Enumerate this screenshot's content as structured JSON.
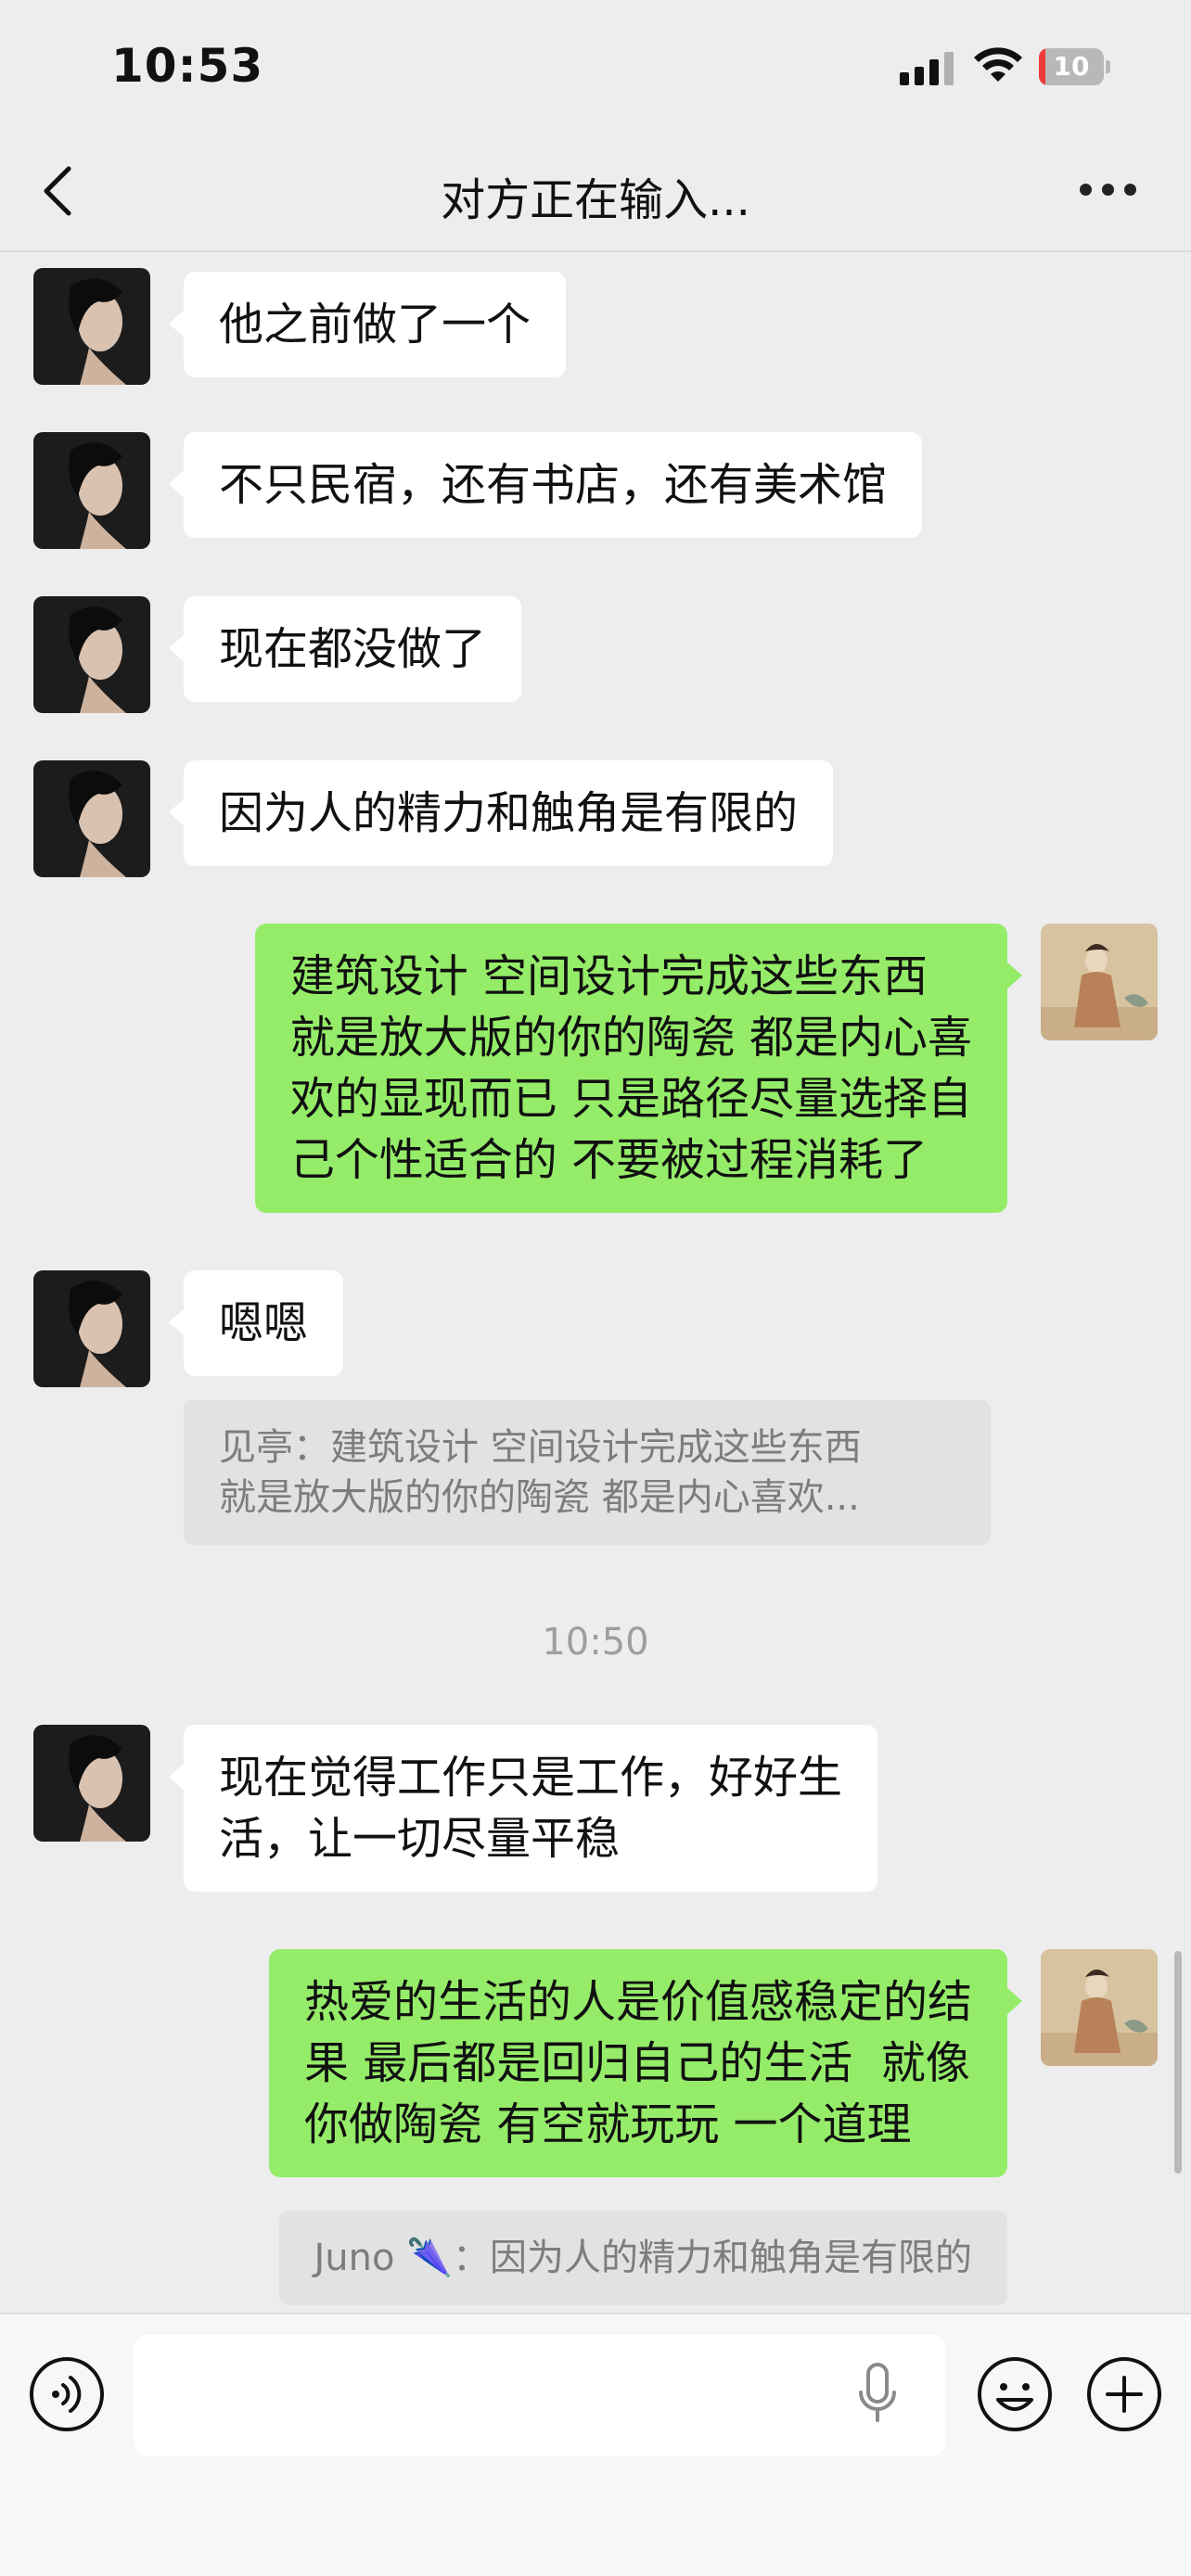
{
  "status_bar": {
    "time": "10:53",
    "battery_level": "10",
    "battery_percent": 10,
    "signal_icon": "cellular-signal-icon",
    "wifi_icon": "wifi-icon"
  },
  "nav": {
    "title": "对方正在输入...",
    "back_icon": "chevron-left-icon",
    "more_icon": "ellipsis-icon"
  },
  "messages": [
    {
      "side": "in",
      "text": "他之前做了一个"
    },
    {
      "side": "in",
      "text": "不只民宿，还有书店，还有美术馆"
    },
    {
      "side": "in",
      "text": "现在都没做了"
    },
    {
      "side": "in",
      "text": "因为人的精力和触角是有限的"
    },
    {
      "side": "out",
      "text": "建筑设计 空间设计完成这些东西\n就是放大版的你的陶瓷 都是内心喜\n欢的显现而已 只是路径尽量选择自\n己个性适合的 不要被过程消耗了"
    },
    {
      "side": "in",
      "text": "嗯嗯",
      "quote": "见亭：建筑设计 空间设计完成这些东西\n就是放大版的你的陶瓷 都是内心喜欢..."
    },
    {
      "side": "in",
      "text": "现在觉得工作只是工作，好好生\n活，让一切尽量平稳"
    },
    {
      "side": "out",
      "text": "热爱的生活的人是价值感稳定的结\n果 最后都是回归自己的生活  就像\n你做陶瓷 有空就玩玩 一个道理",
      "quote": "Juno 🌂：因为人的精力和触角是有限的"
    }
  ],
  "time_divider": "10:50",
  "input_bar": {
    "voice_icon": "voice-mode-icon",
    "input_value": "",
    "mic_icon": "microphone-icon",
    "emoji_icon": "emoji-icon",
    "plus_icon": "plus-icon"
  },
  "colors": {
    "background": "#ededed",
    "incoming_bubble": "#ffffff",
    "outgoing_bubble": "#95ec69",
    "quote_bg": "#e2e2e2",
    "battery_low": "#f03b3b"
  }
}
